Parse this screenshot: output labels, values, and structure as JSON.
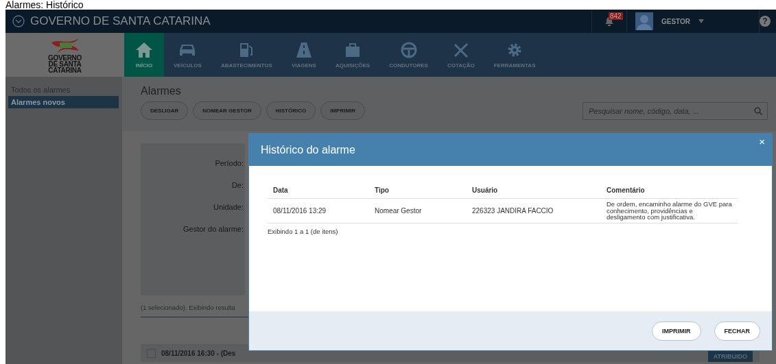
{
  "document_title": "Alarmes: Histórico",
  "header": {
    "title": "GOVERNO DE SANTA CATARINA",
    "notifications": "842",
    "user": "GESTOR",
    "help": "?"
  },
  "logo_text": [
    "GOVERNO",
    "DE SANTA",
    "CATARINA"
  ],
  "nav": [
    {
      "label": "INÍCIO",
      "selected": true
    },
    {
      "label": "VEÍCULOS",
      "selected": false
    },
    {
      "label": "ABASTECIMENTOS",
      "selected": false
    },
    {
      "label": "VIAGENS",
      "selected": false
    },
    {
      "label": "AQUISIÇÕES",
      "selected": false
    },
    {
      "label": "CONDUTORES",
      "selected": false
    },
    {
      "label": "COTAÇÃO",
      "selected": false
    },
    {
      "label": "FERRAMENTAS",
      "selected": false
    }
  ],
  "sidebar": {
    "items": [
      {
        "label": "Todos os alarmes",
        "selected": false
      },
      {
        "label": "Alarmes novos",
        "selected": true
      }
    ]
  },
  "page": {
    "title": "Alarmes",
    "actions": [
      "DESLIGAR",
      "NOMEAR GESTOR",
      "HISTÓRICO",
      "IMPRIMIR"
    ],
    "search": {
      "placeholder": "Pesquisar nome, código, data, ..."
    },
    "filters": [
      "Período:",
      "De:",
      "Unidade:",
      "Gestor do alarme:"
    ],
    "summary": "(1 selecionado). Exibindo resulta",
    "list": [
      {
        "text": "08/11/2016 16:30 - (Des",
        "checked": false,
        "status": "ATRIBUIDO"
      }
    ]
  },
  "modal": {
    "title": "Histórico do alarme",
    "close": "×",
    "columns": [
      "Data",
      "Tipo",
      "Usuário",
      "Comentário"
    ],
    "rows": [
      [
        "08/11/2016 13:29",
        "Nomear Gestor",
        "226323 JANDIRA FACCIO",
        "De ordem, encaminho alarme do GVE para conhecimento, providências e desligamento com justificativa."
      ]
    ],
    "footer": "Exibindo 1 a 1 (de itens)",
    "buttons": [
      "IMPRIMIR",
      "FECHAR"
    ]
  }
}
